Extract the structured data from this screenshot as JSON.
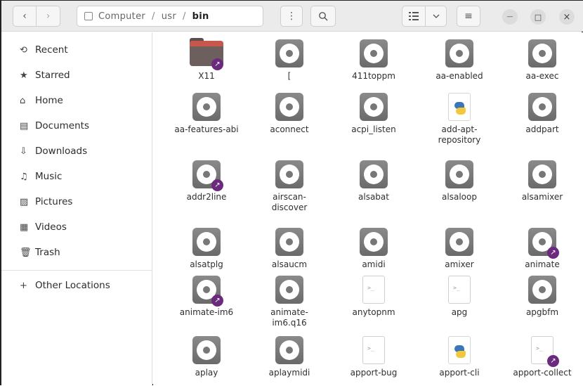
{
  "headerbar": {
    "back_icon": "chevron-left-icon",
    "forward_icon": "chevron-right-icon",
    "path": [
      "Computer",
      "usr",
      "bin"
    ],
    "path_separator": "/",
    "path_menu_label": "⋮",
    "search_icon": "search-icon",
    "view_list_icon": "list-view-icon",
    "view_dropdown_icon": "chevron-down-icon",
    "main_menu_label": "≡",
    "minimize_label": "—",
    "maximize_label": "□",
    "close_label": "×"
  },
  "sidebar": {
    "items": [
      {
        "label": "Recent",
        "icon": "clock-icon",
        "glyph": "⟲"
      },
      {
        "label": "Starred",
        "icon": "star-icon",
        "glyph": "★"
      },
      {
        "label": "Home",
        "icon": "home-icon",
        "glyph": "⌂"
      },
      {
        "label": "Documents",
        "icon": "document-icon",
        "glyph": "▤"
      },
      {
        "label": "Downloads",
        "icon": "download-icon",
        "glyph": "⇩"
      },
      {
        "label": "Music",
        "icon": "music-icon",
        "glyph": "♫"
      },
      {
        "label": "Pictures",
        "icon": "picture-icon",
        "glyph": "▨"
      },
      {
        "label": "Videos",
        "icon": "video-icon",
        "glyph": "▦"
      },
      {
        "label": "Trash",
        "icon": "trash-icon",
        "glyph": "🗑"
      },
      {
        "label": "Other Locations",
        "icon": "plus-icon",
        "glyph": "+"
      }
    ]
  },
  "files": [
    {
      "name": "X11",
      "type": "folder",
      "link": true
    },
    {
      "name": "[",
      "type": "exec",
      "link": false
    },
    {
      "name": "411toppm",
      "type": "exec",
      "link": false
    },
    {
      "name": "aa-enabled",
      "type": "exec",
      "link": false
    },
    {
      "name": "aa-exec",
      "type": "exec",
      "link": false
    },
    {
      "name": "aa-features-abi",
      "type": "exec",
      "link": false
    },
    {
      "name": "aconnect",
      "type": "exec",
      "link": false
    },
    {
      "name": "acpi_listen",
      "type": "exec",
      "link": false
    },
    {
      "name": "add-apt-repository",
      "type": "python",
      "link": false
    },
    {
      "name": "addpart",
      "type": "exec",
      "link": false
    },
    {
      "name": "addr2line",
      "type": "exec",
      "link": true
    },
    {
      "name": "airscan-discover",
      "type": "exec",
      "link": false
    },
    {
      "name": "alsabat",
      "type": "exec",
      "link": false
    },
    {
      "name": "alsaloop",
      "type": "exec",
      "link": false
    },
    {
      "name": "alsamixer",
      "type": "exec",
      "link": false
    },
    {
      "name": "alsatplg",
      "type": "exec",
      "link": false
    },
    {
      "name": "alsaucm",
      "type": "exec",
      "link": false
    },
    {
      "name": "amidi",
      "type": "exec",
      "link": false
    },
    {
      "name": "amixer",
      "type": "exec",
      "link": false
    },
    {
      "name": "animate",
      "type": "exec",
      "link": true
    },
    {
      "name": "animate-im6",
      "type": "exec",
      "link": true
    },
    {
      "name": "animate-im6.q16",
      "type": "exec",
      "link": false
    },
    {
      "name": "anytopnm",
      "type": "script",
      "link": false
    },
    {
      "name": "apg",
      "type": "script",
      "link": false
    },
    {
      "name": "apgbfm",
      "type": "exec",
      "link": false
    },
    {
      "name": "aplay",
      "type": "exec",
      "link": false
    },
    {
      "name": "aplaymidi",
      "type": "exec",
      "link": false
    },
    {
      "name": "apport-bug",
      "type": "script",
      "link": false
    },
    {
      "name": "apport-cli",
      "type": "python",
      "link": false
    },
    {
      "name": "apport-collect",
      "type": "script",
      "link": true
    }
  ],
  "script_glyph": ">_",
  "link_glyph": "↗"
}
